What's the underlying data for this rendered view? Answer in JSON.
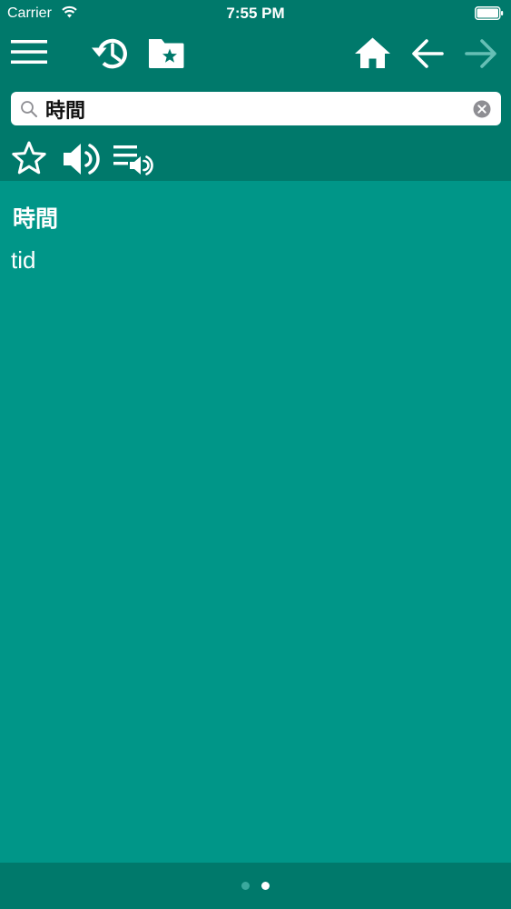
{
  "status_bar": {
    "carrier": "Carrier",
    "time": "7:55 PM"
  },
  "toolbar": {
    "icons": {
      "menu": "hamburger-menu-icon",
      "history": "history-clock-icon",
      "favorites": "folder-star-icon",
      "home": "home-icon",
      "back": "arrow-left-icon",
      "forward": "arrow-right-icon"
    },
    "forward_enabled": false
  },
  "search": {
    "value": "時間",
    "placeholder": ""
  },
  "actions": {
    "icons": {
      "favorite": "star-outline-icon",
      "speak": "speaker-icon",
      "speak_list": "playlist-speaker-icon"
    }
  },
  "entry": {
    "word": "時間",
    "translation": "tid"
  },
  "pager": {
    "page_count": 2,
    "current_page": 2
  },
  "colors": {
    "toolbar_background": "#00796b",
    "content_background": "#009688",
    "icon_color": "#ffffff",
    "disabled_icon_color": "#66bfb5",
    "search_background": "#ffffff"
  }
}
